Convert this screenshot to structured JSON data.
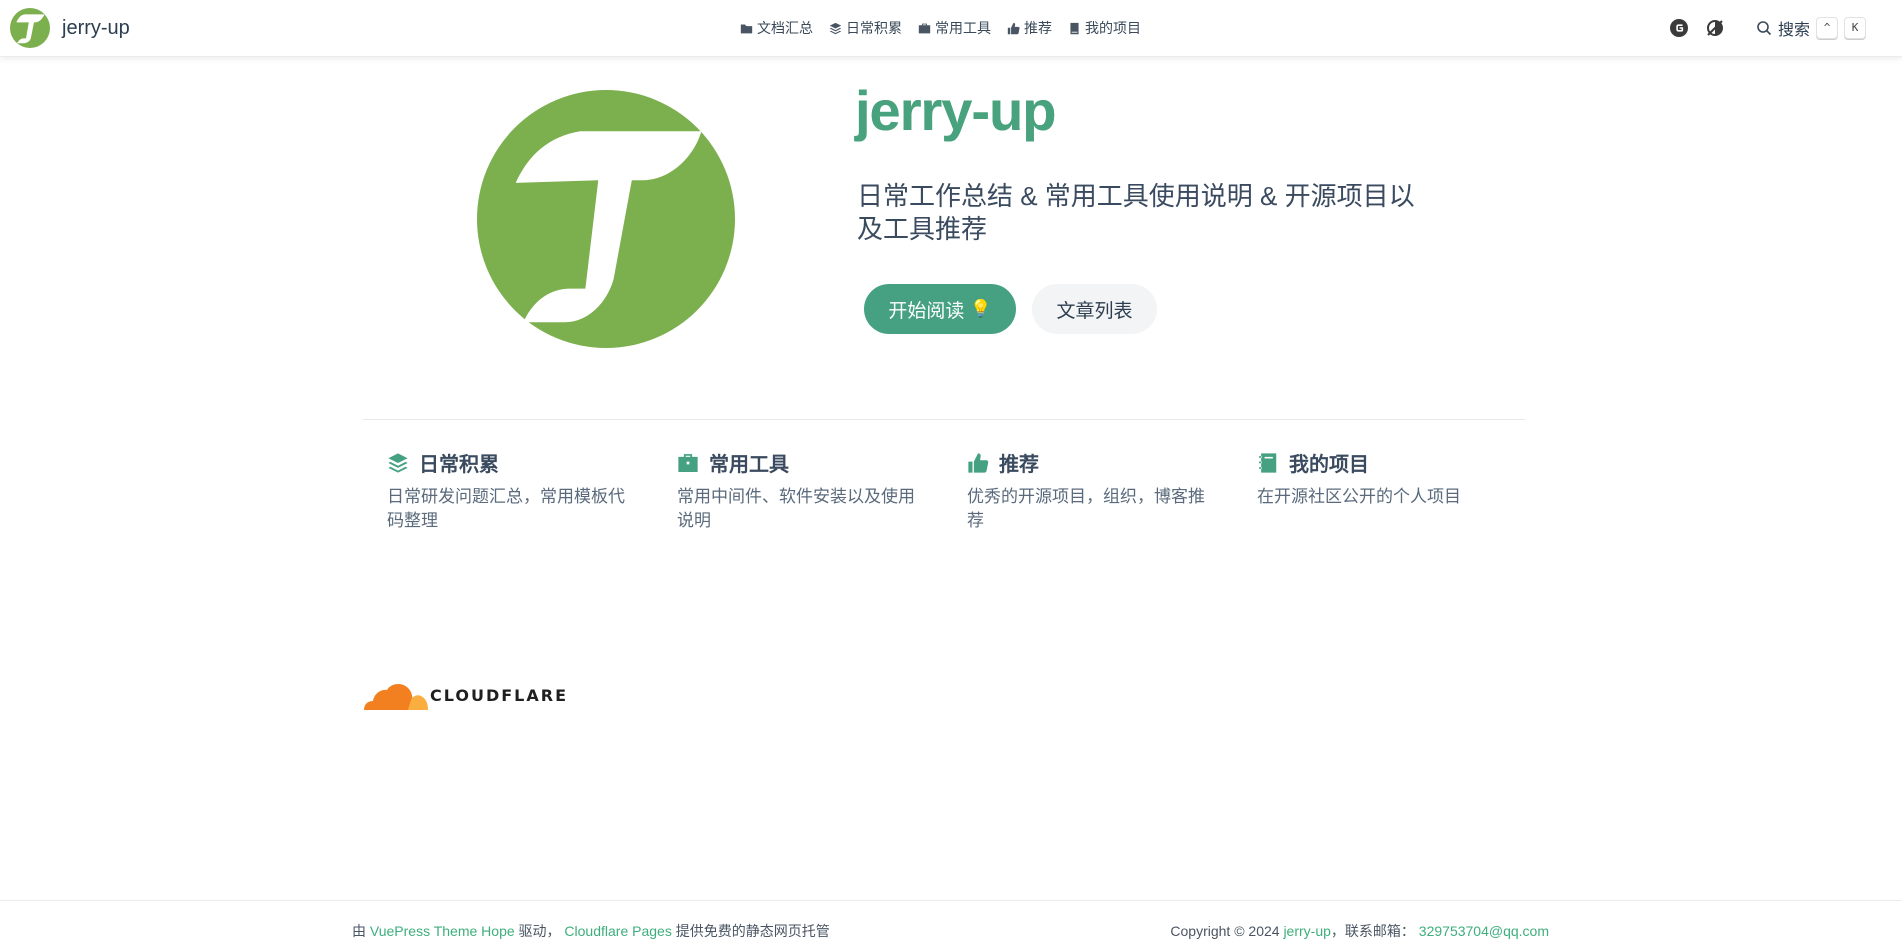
{
  "brand": {
    "title": "jerry-up"
  },
  "nav": {
    "links": [
      {
        "label": "文档汇总",
        "icon": "folder-icon"
      },
      {
        "label": "日常积累",
        "icon": "layers-icon"
      },
      {
        "label": "常用工具",
        "icon": "toolbox-icon"
      },
      {
        "label": "推荐",
        "icon": "thumbs-up-icon"
      },
      {
        "label": "我的项目",
        "icon": "book-icon"
      }
    ],
    "search_label": "搜索",
    "search_keys": [
      "^",
      "K"
    ]
  },
  "hero": {
    "title": "jerry-up",
    "description": "日常工作总结 & 常用工具使用说明 & 开源项目以及工具推荐",
    "primary_button": "开始阅读",
    "primary_button_emoji": "💡",
    "secondary_button": "文章列表"
  },
  "features": [
    {
      "title": "日常积累",
      "desc": "日常研发问题汇总，常用模板代码整理",
      "icon": "layers-icon"
    },
    {
      "title": "常用工具",
      "desc": "常用中间件、软件安装以及使用说明",
      "icon": "toolbox-icon"
    },
    {
      "title": "推荐",
      "desc": "优秀的开源项目，组织，博客推荐",
      "icon": "thumbs-up-icon"
    },
    {
      "title": "我的项目",
      "desc": "在开源社区公开的个人项目",
      "icon": "notebook-icon"
    }
  ],
  "cloudflare": {
    "text": "CLOUDFLARE"
  },
  "footer": {
    "prefix": "由",
    "theme_link": "VuePress Theme Hope",
    "middle": "驱动，",
    "pages_link": "Cloudflare Pages",
    "suffix": "提供免费的静态网页托管",
    "copyright": "Copyright © 2024",
    "author_link": "jerry-up",
    "contact": "，联系邮箱：",
    "email": "329753704@qq.com"
  },
  "colors": {
    "accent": "#45a182",
    "logo_green": "#7cb04e",
    "link": "#3eaf7c"
  }
}
